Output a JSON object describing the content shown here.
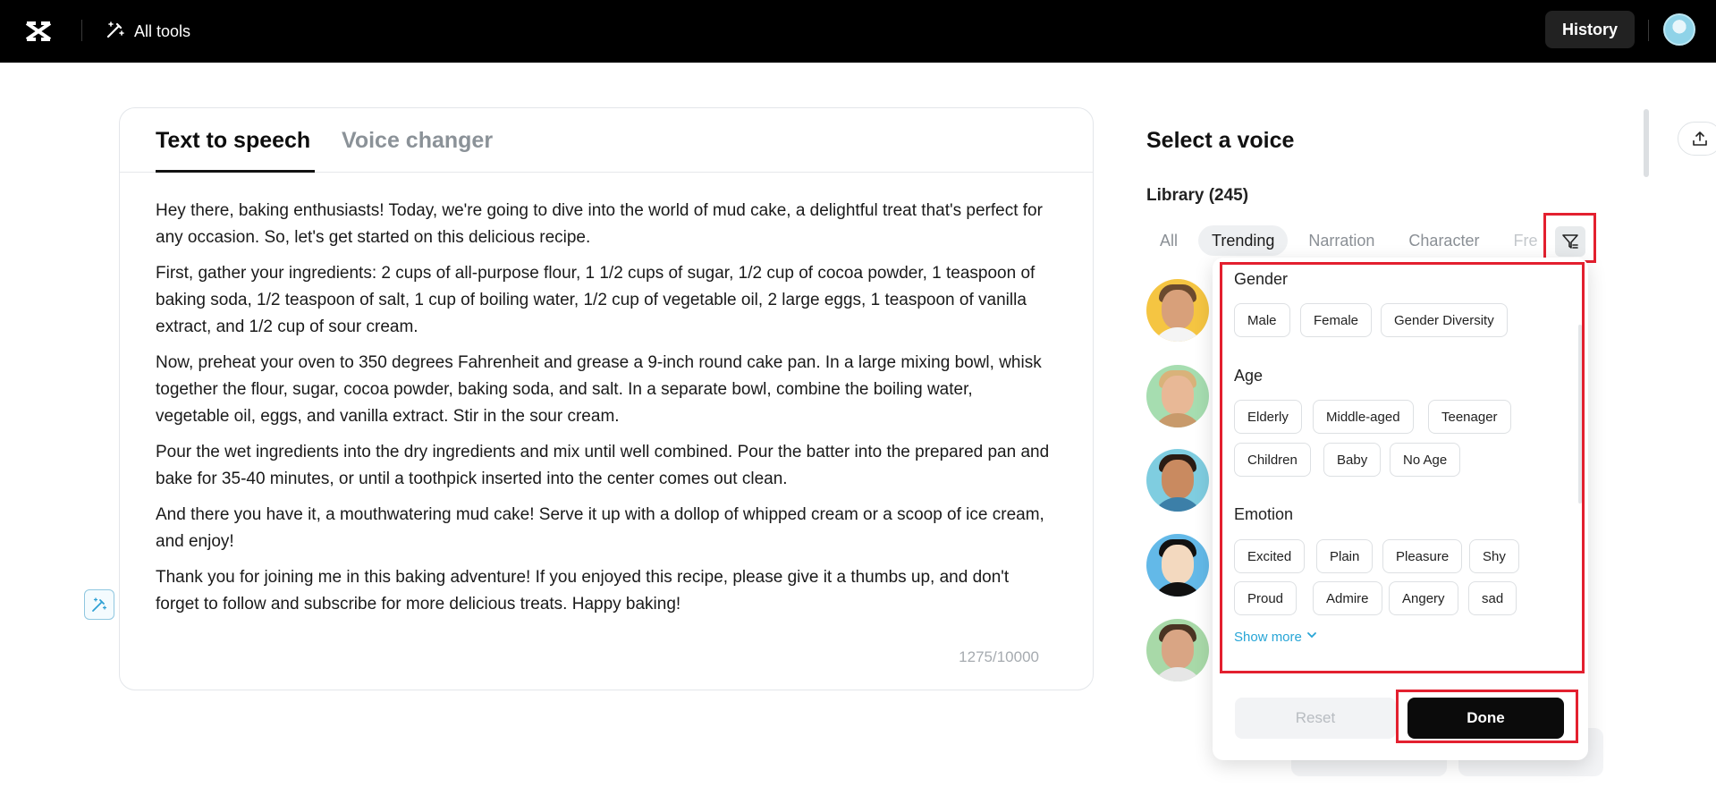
{
  "topbar": {
    "all_tools_label": "All tools",
    "history_label": "History"
  },
  "editor": {
    "tabs": [
      {
        "label": "Text to speech",
        "active": true
      },
      {
        "label": "Voice changer",
        "active": false
      }
    ],
    "paragraphs": [
      "Hey there, baking enthusiasts! Today, we're going to dive into the world of mud cake, a delightful treat that's perfect for any occasion. So, let's get started on this delicious recipe.",
      "First, gather your ingredients: 2 cups of all-purpose flour, 1 1/2 cups of sugar, 1/2 cup of cocoa powder, 1 teaspoon of baking soda, 1/2 teaspoon of salt, 1 cup of boiling water, 1/2 cup of vegetable oil, 2 large eggs, 1 teaspoon of vanilla extract, and 1/2 cup of sour cream.",
      "Now, preheat your oven to 350 degrees Fahrenheit and grease a 9-inch round cake pan. In a large mixing bowl, whisk together the flour, sugar, cocoa powder, baking soda, and salt. In a separate bowl, combine the boiling water, vegetable oil, eggs, and vanilla extract. Stir in the sour cream.",
      "Pour the wet ingredients into the dry ingredients and mix until well combined. Pour the batter into the prepared pan and bake for 35-40 minutes, or until a toothpick inserted into the center comes out clean.",
      "And there you have it, a mouthwatering mud cake! Serve it up with a dollop of whipped cream or a scoop of ice cream, and enjoy!",
      "Thank you for joining me in this baking adventure! If you enjoyed this recipe, please give it a thumbs up, and don't forget to follow and subscribe for more delicious treats. Happy baking!"
    ],
    "char_count": "1275/10000"
  },
  "voice_panel": {
    "title": "Select a voice",
    "library_label": "Library (245)",
    "filters": [
      "All",
      "Trending",
      "Narration",
      "Character",
      "Fre"
    ],
    "active_filter": "Trending"
  },
  "filter_popup": {
    "gender": {
      "title": "Gender",
      "options": [
        "Male",
        "Female",
        "Gender Diversity"
      ]
    },
    "age": {
      "title": "Age",
      "options": [
        "Elderly",
        "Middle-aged",
        "Teenager",
        "Children",
        "Baby",
        "No Age"
      ]
    },
    "emotion": {
      "title": "Emotion",
      "options": [
        "Excited",
        "Plain",
        "Pleasure",
        "Shy",
        "Proud",
        "Admire",
        "Angery",
        "sad"
      ]
    },
    "show_more": "Show more",
    "reset_label": "Reset",
    "done_label": "Done"
  },
  "colors": {
    "highlight": "#e3202f",
    "accent": "#27a5d6",
    "topbar": "#000000"
  }
}
